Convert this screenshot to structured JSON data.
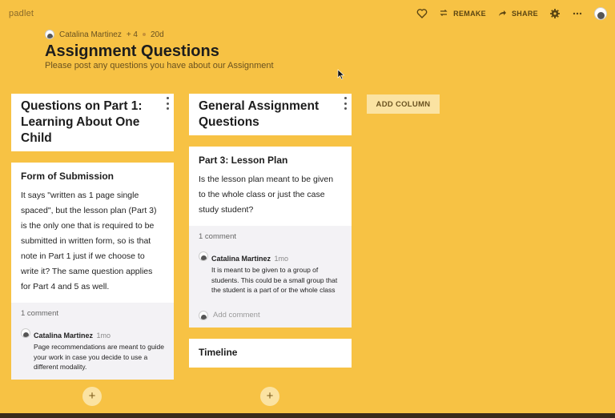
{
  "app": {
    "logo": "padlet"
  },
  "toolbar": {
    "remake_label": "REMAKE",
    "share_label": "SHARE"
  },
  "header": {
    "author": "Catalina Martinez",
    "contributors": "+ 4",
    "age": "20d",
    "title": "Assignment Questions",
    "subtitle": "Please post any questions you have about our Assignment"
  },
  "columns": [
    {
      "title": "Questions on Part 1: Learning About One Child",
      "posts": [
        {
          "title": "Form of Submission",
          "text": "It says \"written as 1 page single spaced\", but the lesson plan (Part 3) is the only one that is required to be submitted in written form, so is that note in Part 1 just if we choose to write it?  The same question applies for Part 4 and 5 as well.",
          "comment_count": "1 comment",
          "comment": {
            "author": "Catalina Martinez",
            "time": "1mo",
            "text": "Page recommendations are meant to guide your work in case you decide to use a different modality."
          }
        }
      ]
    },
    {
      "title": "General Assignment Questions",
      "posts": [
        {
          "title": "Part 3: Lesson Plan",
          "text": "Is the lesson plan meant to be given to the whole class or just the case study student?",
          "comment_count": "1 comment",
          "comment": {
            "author": "Catalina Martinez",
            "time": "1mo",
            "text": "It is meant to be given to a group of students. This could be a small group that the student is a part of or the whole class"
          },
          "add_comment_placeholder": "Add comment"
        },
        {
          "title": "Timeline"
        }
      ]
    }
  ],
  "add_column_label": "ADD COLUMN",
  "add_post_symbol": "+",
  "icons": {
    "like": "heart-icon",
    "remake": "remake-icon",
    "share": "share-arrow-icon",
    "settings": "gear-icon",
    "more": "more-horizontal-icon",
    "profile": "avatar"
  },
  "colors": {
    "background": "#f7c244",
    "card": "#ffffff",
    "comment_bg": "#f3f2f5",
    "button_soft": "#fbe3a2"
  }
}
